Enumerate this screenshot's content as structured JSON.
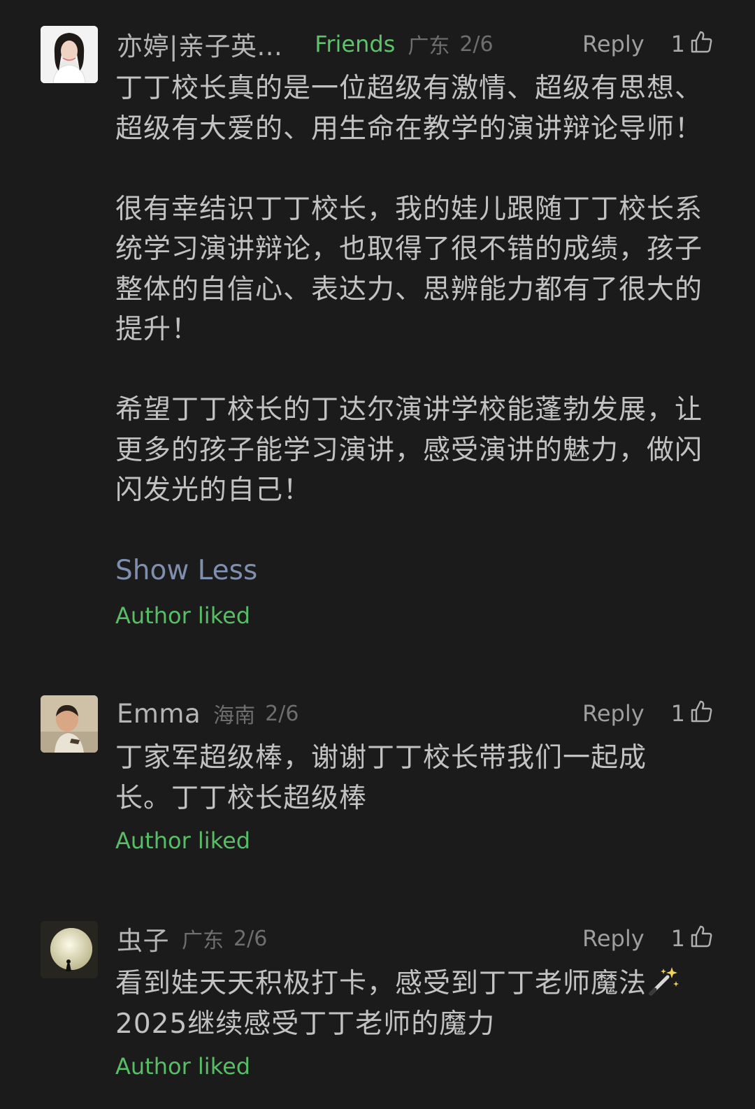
{
  "comments": [
    {
      "name": "亦婷|亲子英...",
      "badge": "Friends",
      "region": "广东",
      "date": "2/6",
      "reply_label": "Reply",
      "like_count": "1",
      "paragraphs": [
        "丁丁校长真的是一位超级有激情、超级有思想、超级有大爱的、用生命在教学的演讲辩论导师！",
        "很有幸结识丁丁校长，我的娃儿跟随丁丁校长系统学习演讲辩论，也取得了很不错的成绩，孩子整体的自信心、表达力、思辨能力都有了很大的提升！",
        "希望丁丁校长的丁达尔演讲学校能蓬勃发展，让更多的孩子能学习演讲，感受演讲的魅力，做闪闪发光的自己！"
      ],
      "show_less_label": "Show Less",
      "author_liked_label": "Author liked"
    },
    {
      "name": "Emma",
      "region": "海南",
      "date": "2/6",
      "reply_label": "Reply",
      "like_count": "1",
      "text": "丁家军超级棒，谢谢丁丁校长带我们一起成长。丁丁校长超级棒",
      "author_liked_label": "Author liked"
    },
    {
      "name": "虫子",
      "region": "广东",
      "date": "2/6",
      "reply_label": "Reply",
      "like_count": "1",
      "text_line1": "看到娃天天积极打卡，感受到丁丁老师魔法",
      "text_line2": "2025继续感受丁丁老师的魔力",
      "emoji": "magic-wand-icon",
      "author_liked_label": "Author liked"
    }
  ],
  "colors": {
    "background": "#1b1b1b",
    "friends_green": "#5cc46a",
    "author_liked_green": "#58bd66",
    "show_less_blue": "#7f8fae"
  }
}
